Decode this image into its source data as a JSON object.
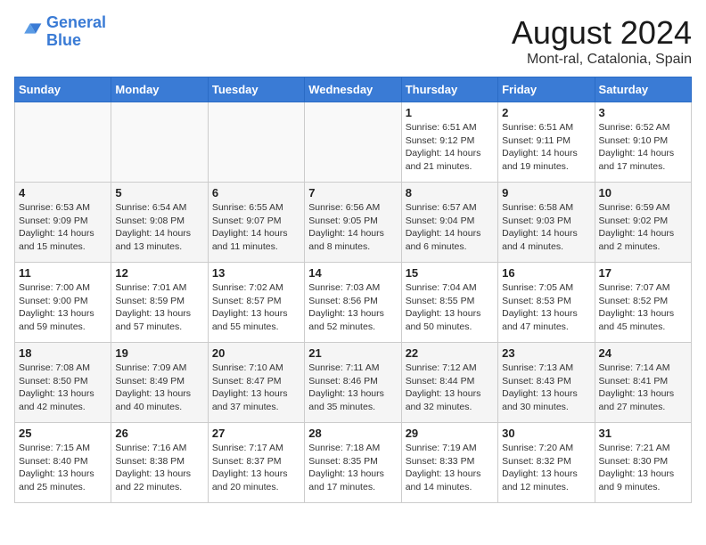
{
  "logo": {
    "line1": "General",
    "line2": "Blue"
  },
  "title": "August 2024",
  "location": "Mont-ral, Catalonia, Spain",
  "days_of_week": [
    "Sunday",
    "Monday",
    "Tuesday",
    "Wednesday",
    "Thursday",
    "Friday",
    "Saturday"
  ],
  "weeks": [
    [
      {
        "day": "",
        "info": ""
      },
      {
        "day": "",
        "info": ""
      },
      {
        "day": "",
        "info": ""
      },
      {
        "day": "",
        "info": ""
      },
      {
        "day": "1",
        "info": "Sunrise: 6:51 AM\nSunset: 9:12 PM\nDaylight: 14 hours\nand 21 minutes."
      },
      {
        "day": "2",
        "info": "Sunrise: 6:51 AM\nSunset: 9:11 PM\nDaylight: 14 hours\nand 19 minutes."
      },
      {
        "day": "3",
        "info": "Sunrise: 6:52 AM\nSunset: 9:10 PM\nDaylight: 14 hours\nand 17 minutes."
      }
    ],
    [
      {
        "day": "4",
        "info": "Sunrise: 6:53 AM\nSunset: 9:09 PM\nDaylight: 14 hours\nand 15 minutes."
      },
      {
        "day": "5",
        "info": "Sunrise: 6:54 AM\nSunset: 9:08 PM\nDaylight: 14 hours\nand 13 minutes."
      },
      {
        "day": "6",
        "info": "Sunrise: 6:55 AM\nSunset: 9:07 PM\nDaylight: 14 hours\nand 11 minutes."
      },
      {
        "day": "7",
        "info": "Sunrise: 6:56 AM\nSunset: 9:05 PM\nDaylight: 14 hours\nand 8 minutes."
      },
      {
        "day": "8",
        "info": "Sunrise: 6:57 AM\nSunset: 9:04 PM\nDaylight: 14 hours\nand 6 minutes."
      },
      {
        "day": "9",
        "info": "Sunrise: 6:58 AM\nSunset: 9:03 PM\nDaylight: 14 hours\nand 4 minutes."
      },
      {
        "day": "10",
        "info": "Sunrise: 6:59 AM\nSunset: 9:02 PM\nDaylight: 14 hours\nand 2 minutes."
      }
    ],
    [
      {
        "day": "11",
        "info": "Sunrise: 7:00 AM\nSunset: 9:00 PM\nDaylight: 13 hours\nand 59 minutes."
      },
      {
        "day": "12",
        "info": "Sunrise: 7:01 AM\nSunset: 8:59 PM\nDaylight: 13 hours\nand 57 minutes."
      },
      {
        "day": "13",
        "info": "Sunrise: 7:02 AM\nSunset: 8:57 PM\nDaylight: 13 hours\nand 55 minutes."
      },
      {
        "day": "14",
        "info": "Sunrise: 7:03 AM\nSunset: 8:56 PM\nDaylight: 13 hours\nand 52 minutes."
      },
      {
        "day": "15",
        "info": "Sunrise: 7:04 AM\nSunset: 8:55 PM\nDaylight: 13 hours\nand 50 minutes."
      },
      {
        "day": "16",
        "info": "Sunrise: 7:05 AM\nSunset: 8:53 PM\nDaylight: 13 hours\nand 47 minutes."
      },
      {
        "day": "17",
        "info": "Sunrise: 7:07 AM\nSunset: 8:52 PM\nDaylight: 13 hours\nand 45 minutes."
      }
    ],
    [
      {
        "day": "18",
        "info": "Sunrise: 7:08 AM\nSunset: 8:50 PM\nDaylight: 13 hours\nand 42 minutes."
      },
      {
        "day": "19",
        "info": "Sunrise: 7:09 AM\nSunset: 8:49 PM\nDaylight: 13 hours\nand 40 minutes."
      },
      {
        "day": "20",
        "info": "Sunrise: 7:10 AM\nSunset: 8:47 PM\nDaylight: 13 hours\nand 37 minutes."
      },
      {
        "day": "21",
        "info": "Sunrise: 7:11 AM\nSunset: 8:46 PM\nDaylight: 13 hours\nand 35 minutes."
      },
      {
        "day": "22",
        "info": "Sunrise: 7:12 AM\nSunset: 8:44 PM\nDaylight: 13 hours\nand 32 minutes."
      },
      {
        "day": "23",
        "info": "Sunrise: 7:13 AM\nSunset: 8:43 PM\nDaylight: 13 hours\nand 30 minutes."
      },
      {
        "day": "24",
        "info": "Sunrise: 7:14 AM\nSunset: 8:41 PM\nDaylight: 13 hours\nand 27 minutes."
      }
    ],
    [
      {
        "day": "25",
        "info": "Sunrise: 7:15 AM\nSunset: 8:40 PM\nDaylight: 13 hours\nand 25 minutes."
      },
      {
        "day": "26",
        "info": "Sunrise: 7:16 AM\nSunset: 8:38 PM\nDaylight: 13 hours\nand 22 minutes."
      },
      {
        "day": "27",
        "info": "Sunrise: 7:17 AM\nSunset: 8:37 PM\nDaylight: 13 hours\nand 20 minutes."
      },
      {
        "day": "28",
        "info": "Sunrise: 7:18 AM\nSunset: 8:35 PM\nDaylight: 13 hours\nand 17 minutes."
      },
      {
        "day": "29",
        "info": "Sunrise: 7:19 AM\nSunset: 8:33 PM\nDaylight: 13 hours\nand 14 minutes."
      },
      {
        "day": "30",
        "info": "Sunrise: 7:20 AM\nSunset: 8:32 PM\nDaylight: 13 hours\nand 12 minutes."
      },
      {
        "day": "31",
        "info": "Sunrise: 7:21 AM\nSunset: 8:30 PM\nDaylight: 13 hours\nand 9 minutes."
      }
    ]
  ]
}
